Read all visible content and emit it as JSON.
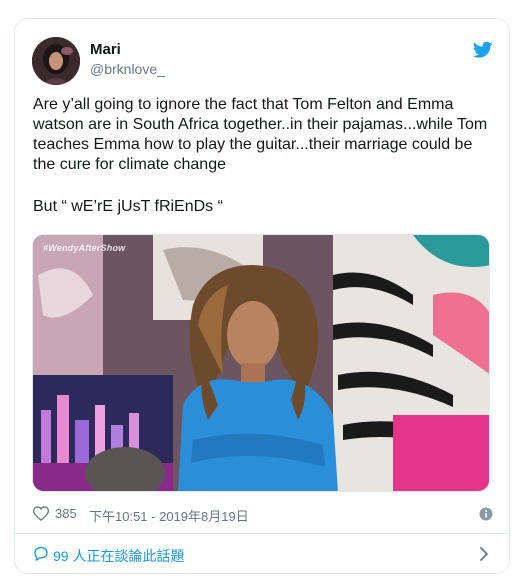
{
  "user": {
    "name": "Mari",
    "handle": "@brknlove_"
  },
  "tweet": {
    "text": "Are y’all going to ignore the fact that Tom Felton and Emma watson are in South Africa together..in their pajamas...while Tom teaches Emma how to play the guitar...their marriage could be the cure for climate change",
    "text2": "But “ wE’rE jUsT fRiEnDs “"
  },
  "media": {
    "watermark": "#WendyAfterShow"
  },
  "meta": {
    "likes": "385",
    "timestamp": "下午10:51 - 2019年8月19日"
  },
  "footer": {
    "discussion": "99 人正在談論此話題"
  },
  "icons": {
    "brand": "twitter-bird-icon",
    "like": "heart-icon",
    "info": "info-icon",
    "reply": "speech-bubble-icon",
    "more": "chevron-right-icon"
  },
  "colors": {
    "twitter_blue": "#1da1f2",
    "link_blue": "#1b95e0",
    "secondary_text": "#657786",
    "border": "#e1e8ed"
  }
}
